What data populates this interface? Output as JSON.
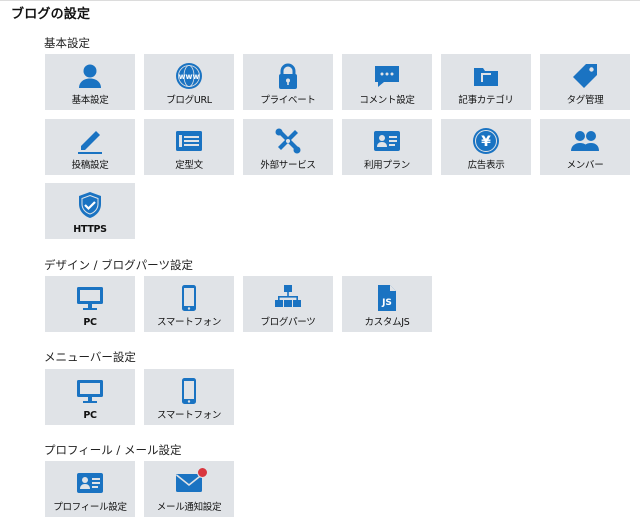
{
  "page_title": "ブログの設定",
  "colors": {
    "icon": "#1a73c2",
    "tile_bg": "#e0e3e7",
    "badge": "#d9363e"
  },
  "sections": {
    "basic": {
      "title": "基本設定",
      "tiles": [
        {
          "label": "基本設定",
          "icon": "user-icon"
        },
        {
          "label": "ブログURL",
          "icon": "www-globe-icon"
        },
        {
          "label": "プライベート",
          "icon": "lock-icon"
        },
        {
          "label": "コメント設定",
          "icon": "comment-icon"
        },
        {
          "label": "記事カテゴリ",
          "icon": "folder-icon"
        },
        {
          "label": "タグ管理",
          "icon": "tag-icon"
        },
        {
          "label": "投稿設定",
          "icon": "pencil-icon"
        },
        {
          "label": "定型文",
          "icon": "template-icon"
        },
        {
          "label": "外部サービス",
          "icon": "tools-icon"
        },
        {
          "label": "利用プラン",
          "icon": "id-card-icon"
        },
        {
          "label": "広告表示",
          "icon": "yen-icon"
        },
        {
          "label": "メンバー",
          "icon": "members-icon"
        },
        {
          "label": "HTTPS",
          "icon": "shield-icon"
        }
      ]
    },
    "design": {
      "title": "デザイン / ブログパーツ設定",
      "tiles": [
        {
          "label": "PC",
          "icon": "monitor-icon"
        },
        {
          "label": "スマートフォン",
          "icon": "smartphone-icon"
        },
        {
          "label": "ブログパーツ",
          "icon": "parts-icon"
        },
        {
          "label": "カスタムJS",
          "icon": "js-file-icon"
        }
      ]
    },
    "menubar": {
      "title": "メニューバー設定",
      "tiles": [
        {
          "label": "PC",
          "icon": "monitor-icon"
        },
        {
          "label": "スマートフォン",
          "icon": "smartphone-icon"
        }
      ]
    },
    "profile": {
      "title": "プロフィール / メール設定",
      "tiles": [
        {
          "label": "プロフィール設定",
          "icon": "profile-card-icon"
        },
        {
          "label": "メール通知設定",
          "icon": "mail-icon",
          "badge": true
        }
      ]
    }
  }
}
